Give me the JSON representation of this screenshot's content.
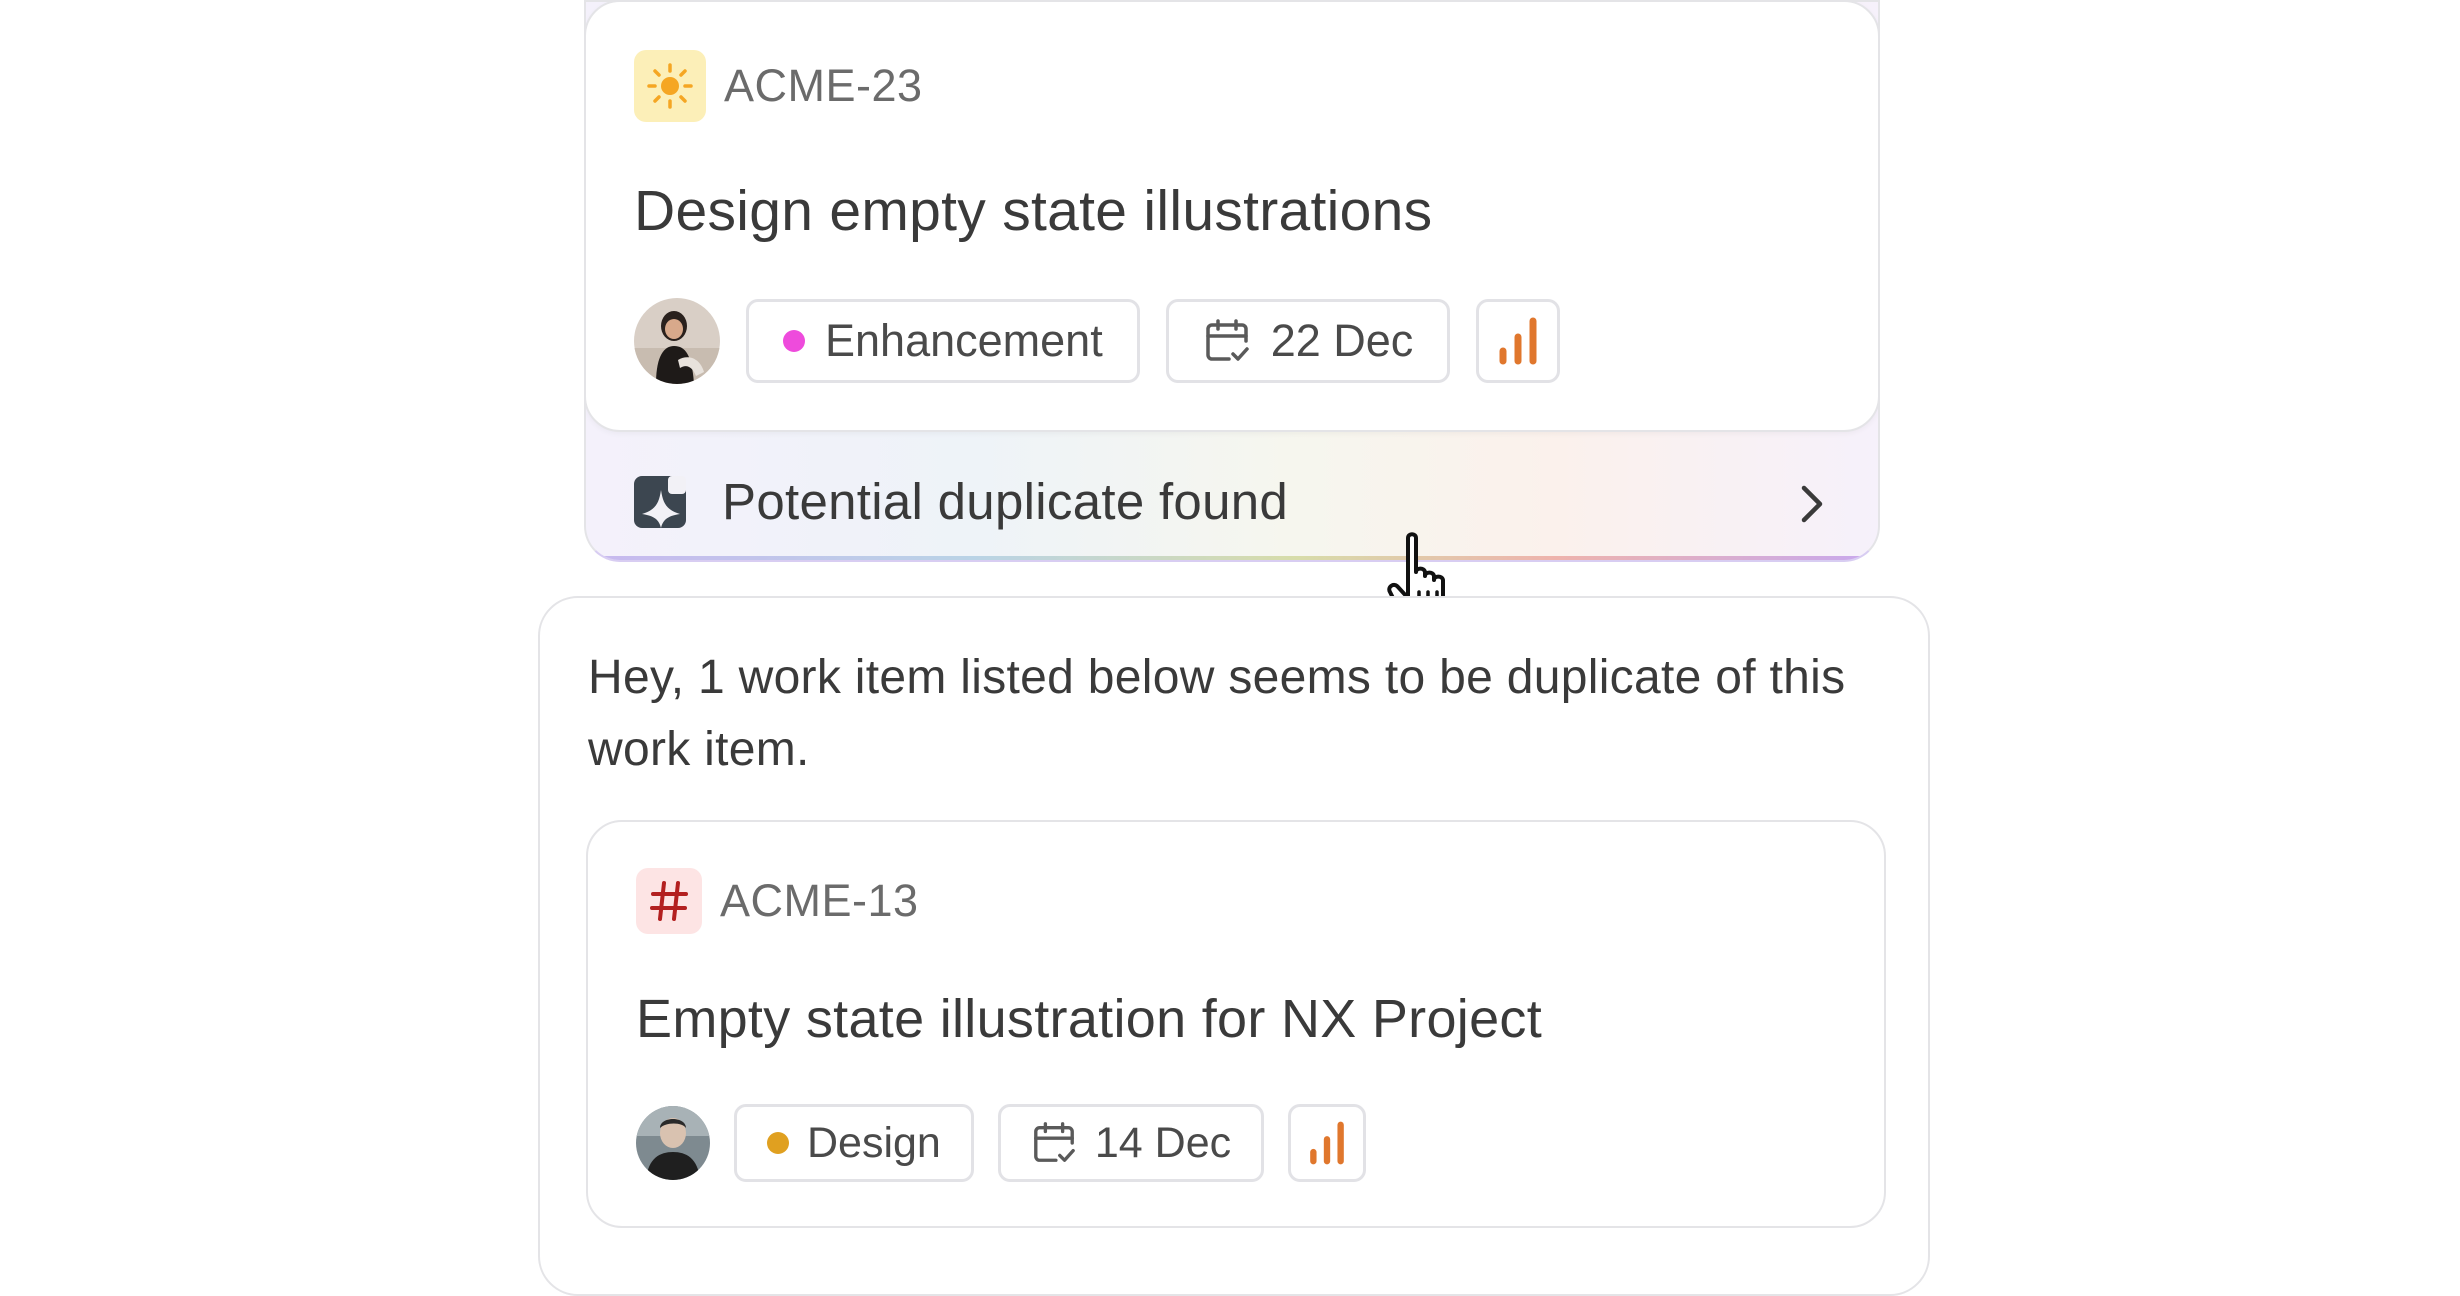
{
  "primary_item": {
    "id": "ACME-23",
    "title": "Design empty state illustrations",
    "label": "Enhancement",
    "label_color": "#ee4bdc",
    "due_date": "22 Dec",
    "priority_color": "#e0772d",
    "type_icon": "sun-icon"
  },
  "duplicate_banner": {
    "text": "Potential duplicate found",
    "icon": "sparkle-icon"
  },
  "duplicate_panel": {
    "message": "Hey, 1 work item listed below seems to be duplicate of this work item.",
    "item": {
      "id": "ACME-13",
      "title": "Empty state illustration for NX Project",
      "label": "Design",
      "label_color": "#e0a020",
      "due_date": "14 Dec",
      "priority_color": "#e0772d",
      "type_icon": "hash-icon"
    }
  }
}
